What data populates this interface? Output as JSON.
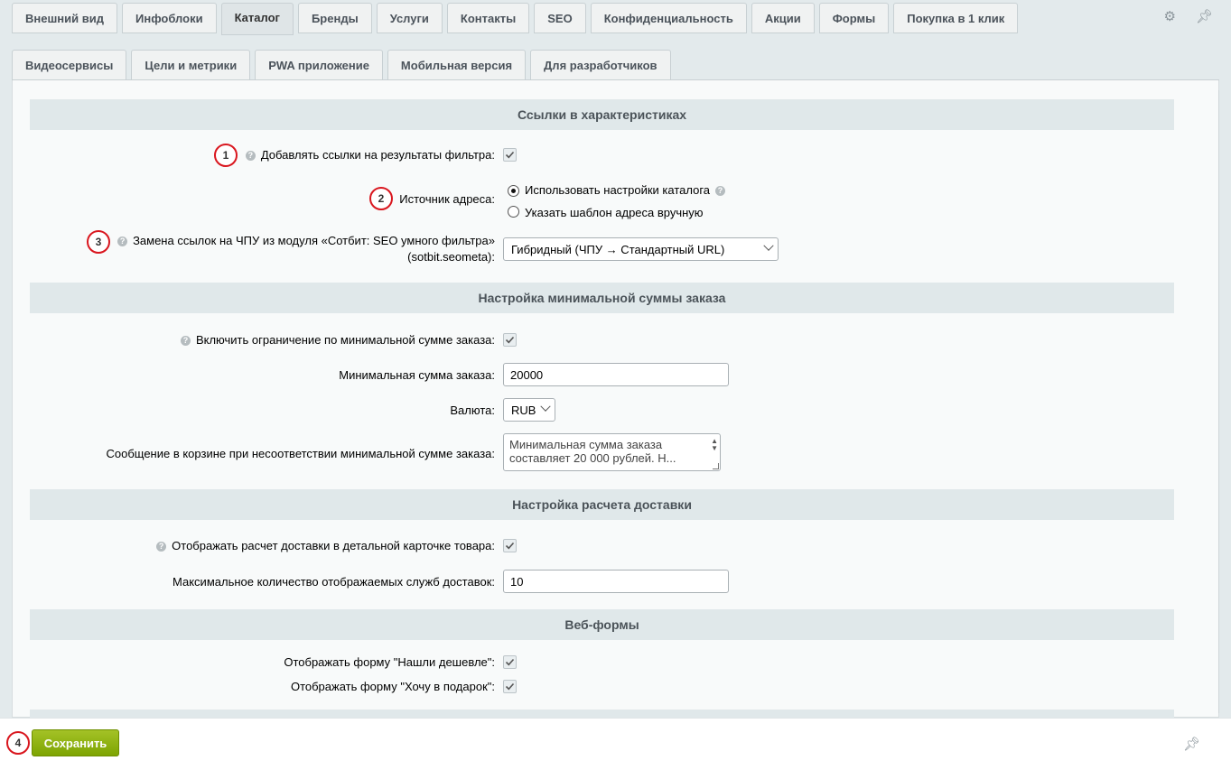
{
  "tabs_row1": [
    {
      "label": "Внешний вид"
    },
    {
      "label": "Инфоблоки"
    },
    {
      "label": "Каталог",
      "active": true
    },
    {
      "label": "Бренды"
    },
    {
      "label": "Услуги"
    },
    {
      "label": "Контакты"
    },
    {
      "label": "SEO"
    },
    {
      "label": "Конфиденциальность"
    },
    {
      "label": "Акции"
    },
    {
      "label": "Формы"
    },
    {
      "label": "Покупка в 1 клик"
    }
  ],
  "tabs_row2": [
    {
      "label": "Видеосервисы"
    },
    {
      "label": "Цели и метрики"
    },
    {
      "label": "PWA приложение"
    },
    {
      "label": "Мобильная версия"
    },
    {
      "label": "Для разработчиков"
    }
  ],
  "icons": {
    "settings": "gear-icon",
    "pin": "pin-icon"
  },
  "sections": {
    "links": "Ссылки в характеристиках",
    "min_order": "Настройка минимальной суммы заказа",
    "delivery": "Настройка расчета доставки",
    "webforms": "Веб-формы"
  },
  "links": {
    "add_links_label": "Добавлять ссылки на результаты фильтра:",
    "add_links_checked": true,
    "source_label": "Источник адреса:",
    "source_opt1": "Использовать настройки каталога",
    "source_opt2": "Указать шаблон адреса вручную",
    "source_selected": 1,
    "replace_label_line1": "Замена ссылок на ЧПУ из модуля «Сотбит: SEO умного фильтра»",
    "replace_label_line2": "(sotbit.seometa):",
    "replace_value": "Гибридный (ЧПУ → Стандартный URL)"
  },
  "min_order": {
    "enable_label": "Включить ограничение по минимальной сумме заказа:",
    "enable_checked": true,
    "sum_label": "Минимальная сумма заказа:",
    "sum_value": "20000",
    "currency_label": "Валюта:",
    "currency_value": "RUB",
    "message_label": "Сообщение в корзине при несоответствии минимальной сумме заказа:",
    "message_value": "Минимальная сумма заказа составляет 20 000 рублей. Н..."
  },
  "delivery": {
    "show_label": "Отображать расчет доставки в детальной карточке товара:",
    "show_checked": true,
    "max_label": "Максимальное количество отображаемых служб доставок:",
    "max_value": "10"
  },
  "webforms": {
    "cheaper_label": "Отображать форму \"Нашли дешевле\":",
    "cheaper_checked": true,
    "gift_label": "Отображать форму \"Хочу в подарок\":",
    "gift_checked": true
  },
  "markers": [
    "1",
    "2",
    "3",
    "4"
  ],
  "save_button": "Сохранить",
  "colors": {
    "accent": "#86ad00",
    "marker": "#d9161e",
    "section_bg": "#e0e8ea"
  }
}
